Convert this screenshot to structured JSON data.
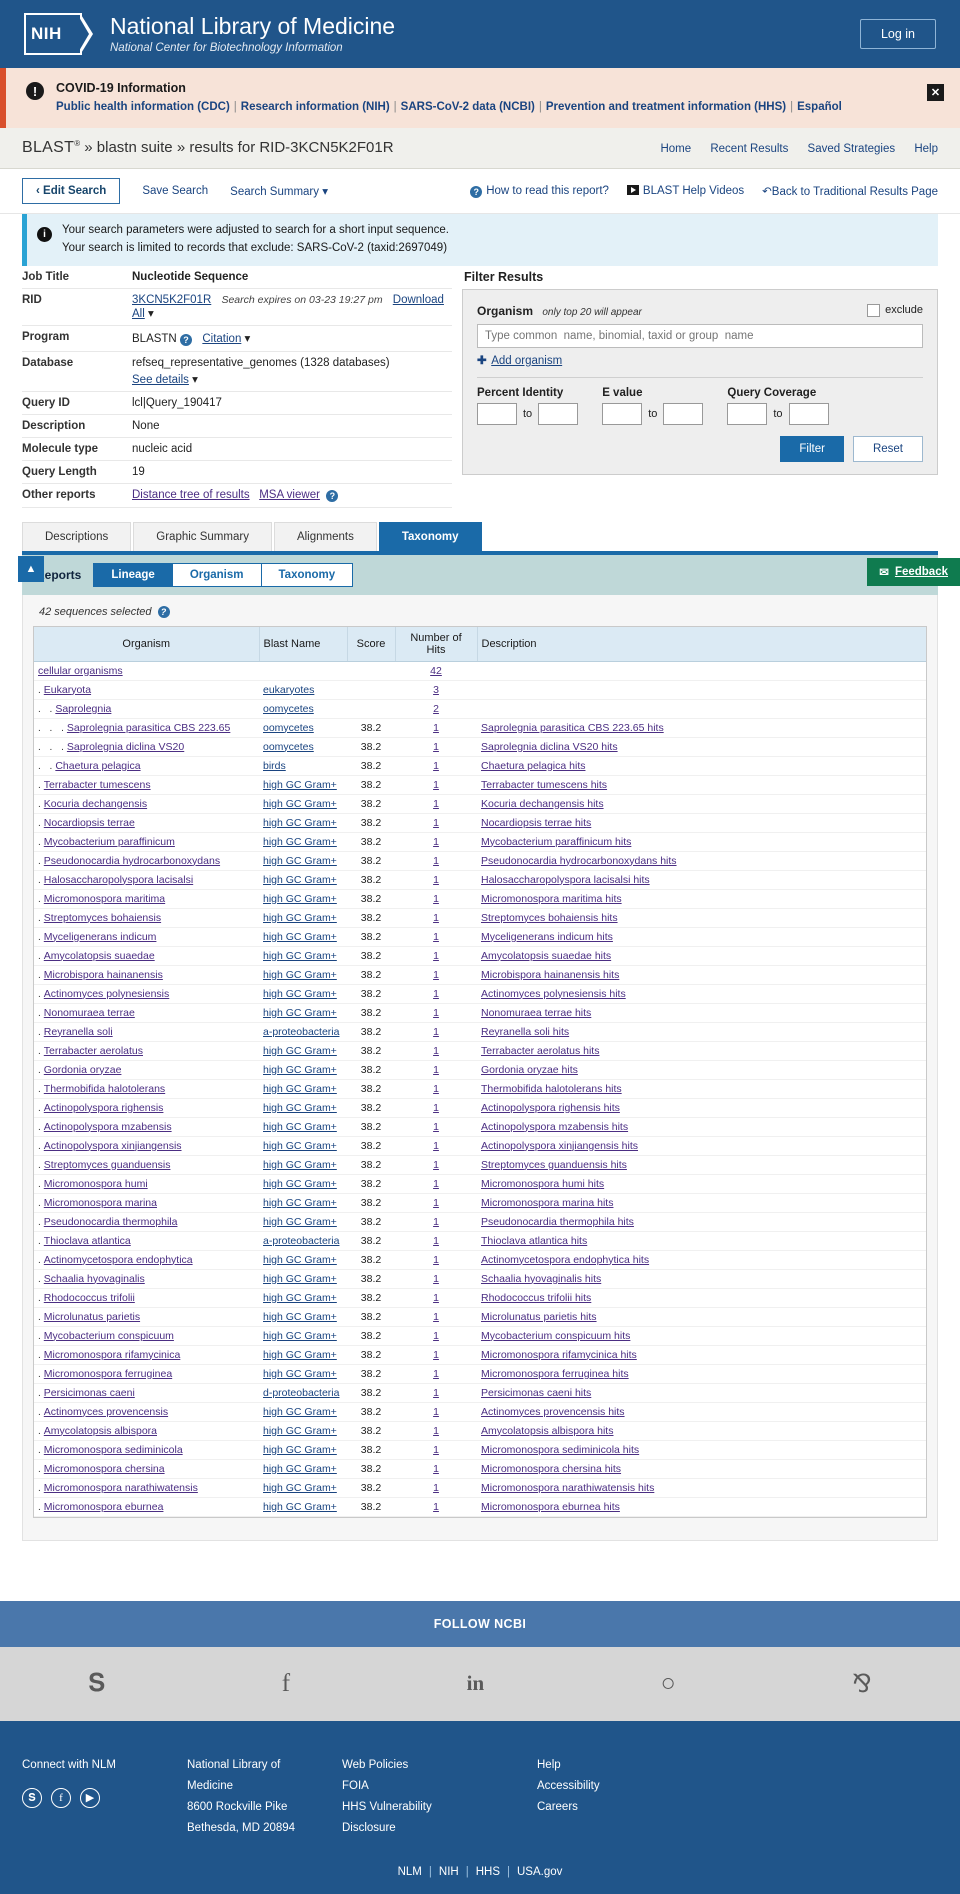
{
  "header": {
    "logo_text": "NIH",
    "title": "National Library of Medicine",
    "subtitle": "National Center for Biotechnology Information",
    "login_label": "Log in"
  },
  "covid": {
    "title": "COVID-19 Information",
    "links": [
      "Public health information (CDC)",
      "Research information (NIH)",
      "SARS-CoV-2 data (NCBI)",
      "Prevention and treatment information (HHS)",
      "Español"
    ],
    "close_label": "✕"
  },
  "blastbar": {
    "brand": "BLAST",
    "sup": "®",
    "crumb": "» blastn suite » results for RID-3KCN5K2F01R",
    "nav": [
      "Home",
      "Recent Results",
      "Saved Strategies",
      "Help"
    ]
  },
  "toolbar": {
    "edit_search": "Edit Search",
    "save_search": "Save Search",
    "search_summary": "Search Summary",
    "how_to_read": "How to read this report?",
    "help_videos": "BLAST Help Videos",
    "back_traditional": "Back to Traditional Results Page"
  },
  "info_note": {
    "line1": "Your search parameters were adjusted to search for a short input sequence.",
    "line2": "Your search is limited to records that exclude: SARS-CoV-2 (taxid:2697049)"
  },
  "job": {
    "rows": [
      {
        "key": "Job Title",
        "value": "Nucleotide Sequence"
      },
      {
        "key": "RID",
        "value": "3KCN5K2F01R"
      },
      {
        "key": "Program",
        "value": "BLASTN"
      },
      {
        "key": "Database",
        "value": "refseq_representative_genomes (1328 databases)"
      },
      {
        "key": "Query ID",
        "value": "lcl|Query_190417"
      },
      {
        "key": "Description",
        "value": "None"
      },
      {
        "key": "Molecule type",
        "value": "nucleic acid"
      },
      {
        "key": "Query Length",
        "value": "19"
      },
      {
        "key": "Other reports",
        "value": ""
      }
    ],
    "rid_expires": "Search expires on 03-23 19:27 pm",
    "download_all": "Download All",
    "citation": "Citation",
    "see_details": "See details",
    "distance_tree": "Distance tree of results",
    "msa_viewer": "MSA viewer"
  },
  "filter": {
    "title": "Filter Results",
    "organism_label": "Organism",
    "organism_hint": "only top 20 will appear",
    "exclude_label": "exclude",
    "organism_placeholder": "Type common  name, binomial, taxid or group  name",
    "add_organism": "Add organism",
    "percent_identity": "Percent Identity",
    "evalue": "E value",
    "query_coverage": "Query Coverage",
    "to": "to",
    "filter_button": "Filter",
    "reset_button": "Reset",
    "pi_from": "",
    "pi_to": "",
    "ev_from": "",
    "ev_to": "",
    "qc_from": "",
    "qc_to": ""
  },
  "tabs": [
    {
      "label": "Descriptions",
      "active": false
    },
    {
      "label": "Graphic Summary",
      "active": false
    },
    {
      "label": "Alignments",
      "active": false
    },
    {
      "label": "Taxonomy",
      "active": true
    }
  ],
  "reports": {
    "label": "Reports",
    "subtabs": [
      {
        "label": "Lineage",
        "active": true
      },
      {
        "label": "Organism",
        "active": false
      },
      {
        "label": "Taxonomy",
        "active": false
      }
    ],
    "selected_text": "42 sequences selected"
  },
  "side": {
    "scroll_up": "▲",
    "feedback": "Feedback"
  },
  "table": {
    "columns": [
      "Organism",
      "Blast Name",
      "Score",
      "Number of Hits",
      "Description"
    ],
    "rows": [
      {
        "indent": 0,
        "organism": "cellular organisms",
        "blast": "",
        "score": "",
        "hits": "42",
        "desc": ""
      },
      {
        "indent": 1,
        "organism": "Eukaryota",
        "blast": "eukaryotes",
        "score": "",
        "hits": "3",
        "desc": ""
      },
      {
        "indent": 2,
        "organism": "Saprolegnia",
        "blast": "oomycetes",
        "score": "",
        "hits": "2",
        "desc": ""
      },
      {
        "indent": 3,
        "organism": "Saprolegnia parasitica CBS 223.65",
        "blast": "oomycetes",
        "score": "38.2",
        "hits": "1",
        "desc": "Saprolegnia parasitica CBS 223.65 hits"
      },
      {
        "indent": 3,
        "organism": "Saprolegnia diclina VS20",
        "blast": "oomycetes",
        "score": "38.2",
        "hits": "1",
        "desc": "Saprolegnia diclina VS20 hits"
      },
      {
        "indent": 2,
        "organism": "Chaetura pelagica",
        "blast": "birds",
        "score": "38.2",
        "hits": "1",
        "desc": "Chaetura pelagica hits"
      },
      {
        "indent": 1,
        "organism": "Terrabacter tumescens",
        "blast": "high GC Gram+",
        "score": "38.2",
        "hits": "1",
        "desc": "Terrabacter tumescens hits"
      },
      {
        "indent": 1,
        "organism": "Kocuria dechangensis",
        "blast": "high GC Gram+",
        "score": "38.2",
        "hits": "1",
        "desc": "Kocuria dechangensis hits"
      },
      {
        "indent": 1,
        "organism": "Nocardiopsis terrae",
        "blast": "high GC Gram+",
        "score": "38.2",
        "hits": "1",
        "desc": "Nocardiopsis terrae hits"
      },
      {
        "indent": 1,
        "organism": "Mycobacterium paraffinicum",
        "blast": "high GC Gram+",
        "score": "38.2",
        "hits": "1",
        "desc": "Mycobacterium paraffinicum hits"
      },
      {
        "indent": 1,
        "organism": "Pseudonocardia hydrocarbonoxydans",
        "blast": "high GC Gram+",
        "score": "38.2",
        "hits": "1",
        "desc": "Pseudonocardia hydrocarbonoxydans hits"
      },
      {
        "indent": 1,
        "organism": "Halosaccharopolyspora lacisalsi",
        "blast": "high GC Gram+",
        "score": "38.2",
        "hits": "1",
        "desc": "Halosaccharopolyspora lacisalsi hits"
      },
      {
        "indent": 1,
        "organism": "Micromonospora maritima",
        "blast": "high GC Gram+",
        "score": "38.2",
        "hits": "1",
        "desc": "Micromonospora maritima hits"
      },
      {
        "indent": 1,
        "organism": "Streptomyces bohaiensis",
        "blast": "high GC Gram+",
        "score": "38.2",
        "hits": "1",
        "desc": "Streptomyces bohaiensis hits"
      },
      {
        "indent": 1,
        "organism": "Myceligenerans indicum",
        "blast": "high GC Gram+",
        "score": "38.2",
        "hits": "1",
        "desc": "Myceligenerans indicum hits"
      },
      {
        "indent": 1,
        "organism": "Amycolatopsis suaedae",
        "blast": "high GC Gram+",
        "score": "38.2",
        "hits": "1",
        "desc": "Amycolatopsis suaedae hits"
      },
      {
        "indent": 1,
        "organism": "Microbispora hainanensis",
        "blast": "high GC Gram+",
        "score": "38.2",
        "hits": "1",
        "desc": "Microbispora hainanensis hits"
      },
      {
        "indent": 1,
        "organism": "Actinomyces polynesiensis",
        "blast": "high GC Gram+",
        "score": "38.2",
        "hits": "1",
        "desc": "Actinomyces polynesiensis hits"
      },
      {
        "indent": 1,
        "organism": "Nonomuraea terrae",
        "blast": "high GC Gram+",
        "score": "38.2",
        "hits": "1",
        "desc": "Nonomuraea terrae hits"
      },
      {
        "indent": 1,
        "organism": "Reyranella soli",
        "blast": "a-proteobacteria",
        "score": "38.2",
        "hits": "1",
        "desc": "Reyranella soli hits"
      },
      {
        "indent": 1,
        "organism": "Terrabacter aerolatus",
        "blast": "high GC Gram+",
        "score": "38.2",
        "hits": "1",
        "desc": "Terrabacter aerolatus hits"
      },
      {
        "indent": 1,
        "organism": "Gordonia oryzae",
        "blast": "high GC Gram+",
        "score": "38.2",
        "hits": "1",
        "desc": "Gordonia oryzae hits"
      },
      {
        "indent": 1,
        "organism": "Thermobifida halotolerans",
        "blast": "high GC Gram+",
        "score": "38.2",
        "hits": "1",
        "desc": "Thermobifida halotolerans hits"
      },
      {
        "indent": 1,
        "organism": "Actinopolyspora righensis",
        "blast": "high GC Gram+",
        "score": "38.2",
        "hits": "1",
        "desc": "Actinopolyspora righensis hits"
      },
      {
        "indent": 1,
        "organism": "Actinopolyspora mzabensis",
        "blast": "high GC Gram+",
        "score": "38.2",
        "hits": "1",
        "desc": "Actinopolyspora mzabensis hits"
      },
      {
        "indent": 1,
        "organism": "Actinopolyspora xinjiangensis",
        "blast": "high GC Gram+",
        "score": "38.2",
        "hits": "1",
        "desc": "Actinopolyspora xinjiangensis hits"
      },
      {
        "indent": 1,
        "organism": "Streptomyces guanduensis",
        "blast": "high GC Gram+",
        "score": "38.2",
        "hits": "1",
        "desc": "Streptomyces guanduensis hits"
      },
      {
        "indent": 1,
        "organism": "Micromonospora humi",
        "blast": "high GC Gram+",
        "score": "38.2",
        "hits": "1",
        "desc": "Micromonospora humi hits"
      },
      {
        "indent": 1,
        "organism": "Micromonospora marina",
        "blast": "high GC Gram+",
        "score": "38.2",
        "hits": "1",
        "desc": "Micromonospora marina hits"
      },
      {
        "indent": 1,
        "organism": "Pseudonocardia thermophila",
        "blast": "high GC Gram+",
        "score": "38.2",
        "hits": "1",
        "desc": "Pseudonocardia thermophila hits"
      },
      {
        "indent": 1,
        "organism": "Thioclava atlantica",
        "blast": "a-proteobacteria",
        "score": "38.2",
        "hits": "1",
        "desc": "Thioclava atlantica hits"
      },
      {
        "indent": 1,
        "organism": "Actinomycetospora endophytica",
        "blast": "high GC Gram+",
        "score": "38.2",
        "hits": "1",
        "desc": "Actinomycetospora endophytica hits"
      },
      {
        "indent": 1,
        "organism": "Schaalia hyovaginalis",
        "blast": "high GC Gram+",
        "score": "38.2",
        "hits": "1",
        "desc": "Schaalia hyovaginalis hits"
      },
      {
        "indent": 1,
        "organism": "Rhodococcus trifolii",
        "blast": "high GC Gram+",
        "score": "38.2",
        "hits": "1",
        "desc": "Rhodococcus trifolii hits"
      },
      {
        "indent": 1,
        "organism": "Microlunatus parietis",
        "blast": "high GC Gram+",
        "score": "38.2",
        "hits": "1",
        "desc": "Microlunatus parietis hits"
      },
      {
        "indent": 1,
        "organism": "Mycobacterium conspicuum",
        "blast": "high GC Gram+",
        "score": "38.2",
        "hits": "1",
        "desc": "Mycobacterium conspicuum hits"
      },
      {
        "indent": 1,
        "organism": "Micromonospora rifamycinica",
        "blast": "high GC Gram+",
        "score": "38.2",
        "hits": "1",
        "desc": "Micromonospora rifamycinica hits"
      },
      {
        "indent": 1,
        "organism": "Micromonospora ferruginea",
        "blast": "high GC Gram+",
        "score": "38.2",
        "hits": "1",
        "desc": "Micromonospora ferruginea hits"
      },
      {
        "indent": 1,
        "organism": "Persicimonas caeni",
        "blast": "d-proteobacteria",
        "score": "38.2",
        "hits": "1",
        "desc": "Persicimonas caeni hits"
      },
      {
        "indent": 1,
        "organism": "Actinomyces provencensis",
        "blast": "high GC Gram+",
        "score": "38.2",
        "hits": "1",
        "desc": "Actinomyces provencensis hits"
      },
      {
        "indent": 1,
        "organism": "Amycolatopsis albispora",
        "blast": "high GC Gram+",
        "score": "38.2",
        "hits": "1",
        "desc": "Amycolatopsis albispora hits"
      },
      {
        "indent": 1,
        "organism": "Micromonospora sediminicola",
        "blast": "high GC Gram+",
        "score": "38.2",
        "hits": "1",
        "desc": "Micromonospora sediminicola hits"
      },
      {
        "indent": 1,
        "organism": "Micromonospora chersina",
        "blast": "high GC Gram+",
        "score": "38.2",
        "hits": "1",
        "desc": "Micromonospora chersina hits"
      },
      {
        "indent": 1,
        "organism": "Micromonospora narathiwatensis",
        "blast": "high GC Gram+",
        "score": "38.2",
        "hits": "1",
        "desc": "Micromonospora narathiwatensis hits"
      },
      {
        "indent": 1,
        "organism": "Micromonospora eburnea",
        "blast": "high GC Gram+",
        "score": "38.2",
        "hits": "1",
        "desc": "Micromonospora eburnea hits"
      }
    ]
  },
  "footer": {
    "follow": "FOLLOW NCBI",
    "social": [
      "twitter-icon",
      "facebook-icon",
      "linkedin-icon",
      "github-icon",
      "rss-icon"
    ],
    "social_glyphs": [
      "𝐲",
      "f",
      "in",
      "()",
      "ɣ"
    ],
    "connect_head": "Connect with NLM",
    "address": [
      "National Library of",
      "Medicine",
      "8600 Rockville Pike",
      "Bethesda, MD 20894"
    ],
    "policies": [
      "Web Policies",
      "FOIA",
      "HHS Vulnerability",
      "Disclosure"
    ],
    "help": [
      "Help",
      "Accessibility",
      "Careers"
    ],
    "bottom": [
      "NLM",
      "NIH",
      "HHS",
      "USA.gov"
    ]
  }
}
